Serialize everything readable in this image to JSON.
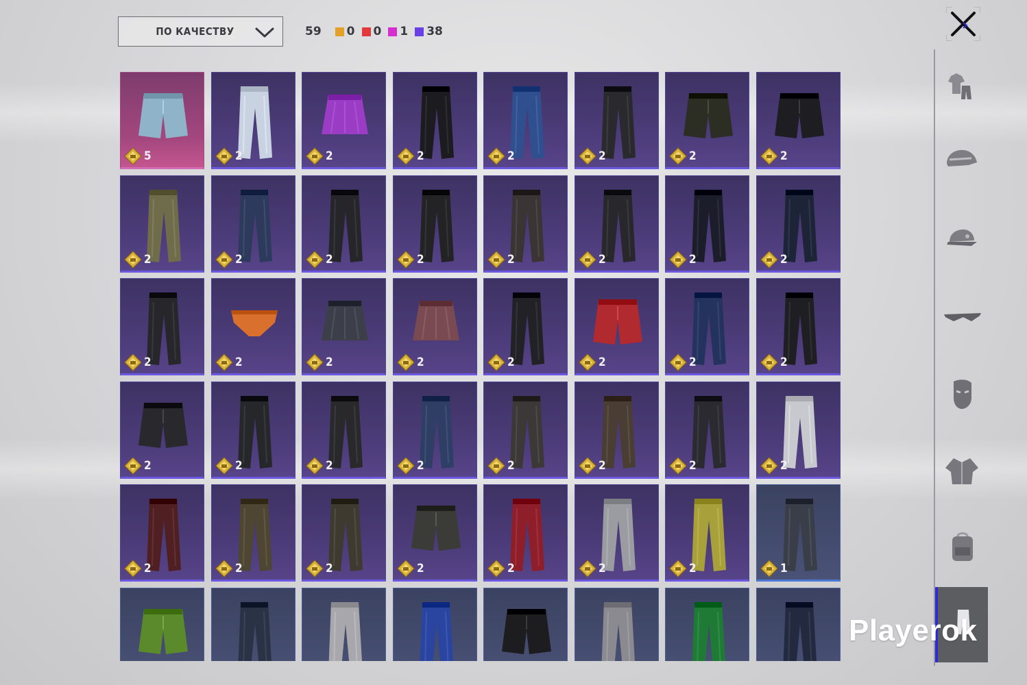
{
  "toolbar": {
    "sort_label": "ПО КАЧЕСТВУ",
    "total_count": "59",
    "quality_counts": [
      {
        "name": "orange",
        "color": "#e3a12a",
        "count": "0"
      },
      {
        "name": "red",
        "color": "#e23a3a",
        "count": "0"
      },
      {
        "name": "magenta",
        "color": "#d42fcf",
        "count": "1"
      },
      {
        "name": "purple",
        "color": "#6a3fe6",
        "count": "38"
      }
    ]
  },
  "sidebar": {
    "categories": [
      {
        "icon": "outfit-icon"
      },
      {
        "icon": "helmet-icon"
      },
      {
        "icon": "cap-icon"
      },
      {
        "icon": "glasses-icon"
      },
      {
        "icon": "mask-icon"
      },
      {
        "icon": "jacket-icon"
      },
      {
        "icon": "backpack-icon"
      },
      {
        "icon": "pants-icon",
        "active": true
      }
    ]
  },
  "items": [
    {
      "type": "shorts",
      "color": "#8fb3c9",
      "rarity": "legend",
      "count": "5"
    },
    {
      "type": "pants",
      "color": "#c9d2e0",
      "rarity": "epic",
      "count": "2"
    },
    {
      "type": "skirt",
      "color": "#9a3cc4",
      "rarity": "epic",
      "count": "2"
    },
    {
      "type": "pants",
      "color": "#1c1c20",
      "rarity": "epic",
      "count": "2"
    },
    {
      "type": "pants",
      "color": "#2f4f8f",
      "rarity": "epic",
      "count": "2"
    },
    {
      "type": "pants",
      "color": "#2a2a2e",
      "rarity": "epic",
      "count": "2"
    },
    {
      "type": "shorts",
      "color": "#2c2e24",
      "rarity": "epic",
      "count": "2"
    },
    {
      "type": "shorts",
      "color": "#1e1e22",
      "rarity": "epic",
      "count": "2"
    },
    {
      "type": "pants",
      "color": "#6e6c4a",
      "rarity": "epic",
      "count": "2"
    },
    {
      "type": "pants",
      "color": "#2d3a5c",
      "rarity": "epic",
      "count": "2"
    },
    {
      "type": "pants",
      "color": "#26262a",
      "rarity": "epic",
      "count": "2"
    },
    {
      "type": "pants",
      "color": "#232326",
      "rarity": "epic",
      "count": "2"
    },
    {
      "type": "pants",
      "color": "#3a3534",
      "rarity": "epic",
      "count": "2"
    },
    {
      "type": "pants",
      "color": "#27272c",
      "rarity": "epic",
      "count": "2"
    },
    {
      "type": "pants",
      "color": "#1b1e2a",
      "rarity": "epic",
      "count": "2"
    },
    {
      "type": "pants",
      "color": "#1e2438",
      "rarity": "epic",
      "count": "2"
    },
    {
      "type": "pants",
      "color": "#27272b",
      "rarity": "epic",
      "count": "2"
    },
    {
      "type": "briefs",
      "color": "#d9702e",
      "rarity": "epic",
      "count": "2"
    },
    {
      "type": "skirt",
      "color": "#3c3f4a",
      "rarity": "epic",
      "count": "2"
    },
    {
      "type": "skirt",
      "color": "#7a4a52",
      "rarity": "epic",
      "count": "2"
    },
    {
      "type": "pants",
      "color": "#222226",
      "rarity": "epic",
      "count": "2"
    },
    {
      "type": "shorts",
      "color": "#b02a30",
      "rarity": "epic",
      "count": "2"
    },
    {
      "type": "pants",
      "color": "#24335e",
      "rarity": "epic",
      "count": "2"
    },
    {
      "type": "pants",
      "color": "#1f1f23",
      "rarity": "epic",
      "count": "2"
    },
    {
      "type": "shorts",
      "color": "#29292d",
      "rarity": "epic",
      "count": "2"
    },
    {
      "type": "pants",
      "color": "#26272b",
      "rarity": "epic",
      "count": "2"
    },
    {
      "type": "pants",
      "color": "#29292c",
      "rarity": "epic",
      "count": "2"
    },
    {
      "type": "pants",
      "color": "#2f3e64",
      "rarity": "epic",
      "count": "2"
    },
    {
      "type": "pants",
      "color": "#3d3838",
      "rarity": "epic",
      "count": "2"
    },
    {
      "type": "pants",
      "color": "#4a3e34",
      "rarity": "epic",
      "count": "2"
    },
    {
      "type": "pants",
      "color": "#2a2a30",
      "rarity": "epic",
      "count": "2"
    },
    {
      "type": "pants",
      "color": "#c7c9cf",
      "rarity": "epic",
      "count": "2"
    },
    {
      "type": "pants",
      "color": "#4f1f22",
      "rarity": "epic",
      "count": "2"
    },
    {
      "type": "pants",
      "color": "#4e4632",
      "rarity": "epic",
      "count": "2"
    },
    {
      "type": "pants",
      "color": "#3e3a30",
      "rarity": "epic",
      "count": "2"
    },
    {
      "type": "shorts",
      "color": "#3b3b38",
      "rarity": "epic",
      "count": "2"
    },
    {
      "type": "pants",
      "color": "#8e1f2a",
      "rarity": "epic",
      "count": "2"
    },
    {
      "type": "pants",
      "color": "#9a9ca2",
      "rarity": "epic",
      "count": "2"
    },
    {
      "type": "pants",
      "color": "#a8a03a",
      "rarity": "epic",
      "count": "2"
    },
    {
      "type": "pants",
      "color": "#3a3e48",
      "rarity": "blue",
      "count": "1"
    },
    {
      "type": "shorts",
      "color": "#5a8a2c",
      "rarity": "blue",
      "count": ""
    },
    {
      "type": "pants",
      "color": "#2a3246",
      "rarity": "blue",
      "count": ""
    },
    {
      "type": "pants",
      "color": "#a8a8ac",
      "rarity": "blue",
      "count": ""
    },
    {
      "type": "pants",
      "color": "#2a45a0",
      "rarity": "blue",
      "count": ""
    },
    {
      "type": "shorts",
      "color": "#1d1d20",
      "rarity": "blue",
      "count": ""
    },
    {
      "type": "pants",
      "color": "#8a8a90",
      "rarity": "blue",
      "count": ""
    },
    {
      "type": "pants",
      "color": "#1f7a35",
      "rarity": "blue",
      "count": ""
    },
    {
      "type": "pants",
      "color": "#232a40",
      "rarity": "blue",
      "count": ""
    }
  ],
  "watermark": "Playerok"
}
